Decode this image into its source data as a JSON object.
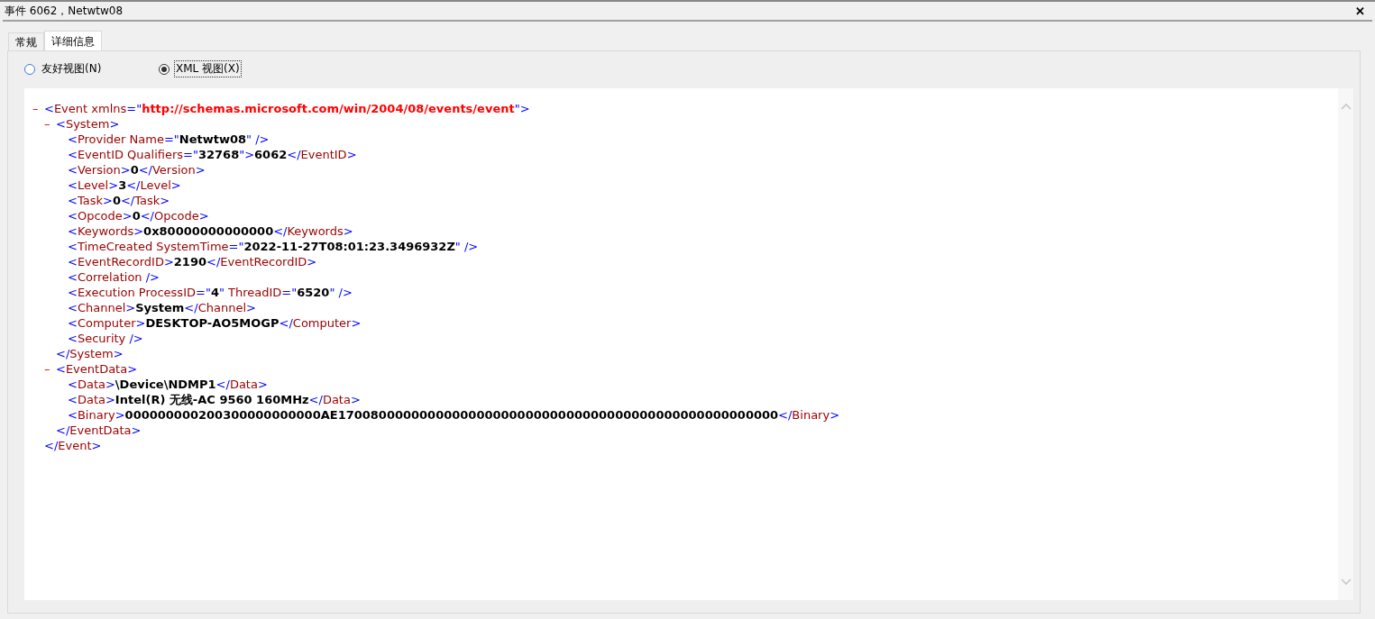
{
  "window": {
    "title": "事件 6062，Netwtw08",
    "close": "✕"
  },
  "tabs": [
    {
      "label": "常规",
      "selected": false
    },
    {
      "label": "详细信息",
      "selected": true
    }
  ],
  "view_options": [
    {
      "label": "友好视图(N)",
      "selected": false
    },
    {
      "label": "XML 视图(X)",
      "selected": true
    }
  ],
  "xml": {
    "toggle": "–",
    "open": [
      {
        "kind": "punct",
        "text": "<"
      },
      {
        "kind": "name",
        "text": "Event xmlns"
      },
      {
        "kind": "punct",
        "text": "=\""
      },
      {
        "kind": "url",
        "text": "http://schemas.microsoft.com/win/2004/08/events/event"
      },
      {
        "kind": "punct",
        "text": "\">"
      }
    ],
    "children": [
      {
        "toggle": "–",
        "open": [
          {
            "kind": "punct",
            "text": "<"
          },
          {
            "kind": "name",
            "text": "System"
          },
          {
            "kind": "punct",
            "text": ">"
          }
        ],
        "children": [
          {
            "open": [
              {
                "kind": "punct",
                "text": "<"
              },
              {
                "kind": "name",
                "text": "Provider Name"
              },
              {
                "kind": "punct",
                "text": "=\""
              },
              {
                "kind": "value",
                "text": "Netwtw08"
              },
              {
                "kind": "punct",
                "text": "\" />"
              }
            ]
          },
          {
            "open": [
              {
                "kind": "punct",
                "text": "<"
              },
              {
                "kind": "name",
                "text": "EventID Qualifiers"
              },
              {
                "kind": "punct",
                "text": "=\""
              },
              {
                "kind": "value",
                "text": "32768"
              },
              {
                "kind": "punct",
                "text": "\">"
              },
              {
                "kind": "value",
                "text": "6062"
              },
              {
                "kind": "punct",
                "text": "</"
              },
              {
                "kind": "name",
                "text": "EventID"
              },
              {
                "kind": "punct",
                "text": ">"
              }
            ]
          },
          {
            "open": [
              {
                "kind": "punct",
                "text": "<"
              },
              {
                "kind": "name",
                "text": "Version"
              },
              {
                "kind": "punct",
                "text": ">"
              },
              {
                "kind": "value",
                "text": "0"
              },
              {
                "kind": "punct",
                "text": "</"
              },
              {
                "kind": "name",
                "text": "Version"
              },
              {
                "kind": "punct",
                "text": ">"
              }
            ]
          },
          {
            "open": [
              {
                "kind": "punct",
                "text": "<"
              },
              {
                "kind": "name",
                "text": "Level"
              },
              {
                "kind": "punct",
                "text": ">"
              },
              {
                "kind": "value",
                "text": "3"
              },
              {
                "kind": "punct",
                "text": "</"
              },
              {
                "kind": "name",
                "text": "Level"
              },
              {
                "kind": "punct",
                "text": ">"
              }
            ]
          },
          {
            "open": [
              {
                "kind": "punct",
                "text": "<"
              },
              {
                "kind": "name",
                "text": "Task"
              },
              {
                "kind": "punct",
                "text": ">"
              },
              {
                "kind": "value",
                "text": "0"
              },
              {
                "kind": "punct",
                "text": "</"
              },
              {
                "kind": "name",
                "text": "Task"
              },
              {
                "kind": "punct",
                "text": ">"
              }
            ]
          },
          {
            "open": [
              {
                "kind": "punct",
                "text": "<"
              },
              {
                "kind": "name",
                "text": "Opcode"
              },
              {
                "kind": "punct",
                "text": ">"
              },
              {
                "kind": "value",
                "text": "0"
              },
              {
                "kind": "punct",
                "text": "</"
              },
              {
                "kind": "name",
                "text": "Opcode"
              },
              {
                "kind": "punct",
                "text": ">"
              }
            ]
          },
          {
            "open": [
              {
                "kind": "punct",
                "text": "<"
              },
              {
                "kind": "name",
                "text": "Keywords"
              },
              {
                "kind": "punct",
                "text": ">"
              },
              {
                "kind": "value",
                "text": "0x80000000000000"
              },
              {
                "kind": "punct",
                "text": "</"
              },
              {
                "kind": "name",
                "text": "Keywords"
              },
              {
                "kind": "punct",
                "text": ">"
              }
            ]
          },
          {
            "open": [
              {
                "kind": "punct",
                "text": "<"
              },
              {
                "kind": "name",
                "text": "TimeCreated SystemTime"
              },
              {
                "kind": "punct",
                "text": "=\""
              },
              {
                "kind": "value",
                "text": "2022-11-27T08:01:23.3496932Z"
              },
              {
                "kind": "punct",
                "text": "\" />"
              }
            ]
          },
          {
            "open": [
              {
                "kind": "punct",
                "text": "<"
              },
              {
                "kind": "name",
                "text": "EventRecordID"
              },
              {
                "kind": "punct",
                "text": ">"
              },
              {
                "kind": "value",
                "text": "2190"
              },
              {
                "kind": "punct",
                "text": "</"
              },
              {
                "kind": "name",
                "text": "EventRecordID"
              },
              {
                "kind": "punct",
                "text": ">"
              }
            ]
          },
          {
            "open": [
              {
                "kind": "punct",
                "text": "<"
              },
              {
                "kind": "name",
                "text": "Correlation"
              },
              {
                "kind": "punct",
                "text": " />"
              }
            ]
          },
          {
            "open": [
              {
                "kind": "punct",
                "text": "<"
              },
              {
                "kind": "name",
                "text": "Execution ProcessID"
              },
              {
                "kind": "punct",
                "text": "=\""
              },
              {
                "kind": "value",
                "text": "4"
              },
              {
                "kind": "punct",
                "text": "\""
              },
              {
                "kind": "name",
                "text": " ThreadID"
              },
              {
                "kind": "punct",
                "text": "=\""
              },
              {
                "kind": "value",
                "text": "6520"
              },
              {
                "kind": "punct",
                "text": "\" />"
              }
            ]
          },
          {
            "open": [
              {
                "kind": "punct",
                "text": "<"
              },
              {
                "kind": "name",
                "text": "Channel"
              },
              {
                "kind": "punct",
                "text": ">"
              },
              {
                "kind": "value",
                "text": "System"
              },
              {
                "kind": "punct",
                "text": "</"
              },
              {
                "kind": "name",
                "text": "Channel"
              },
              {
                "kind": "punct",
                "text": ">"
              }
            ]
          },
          {
            "open": [
              {
                "kind": "punct",
                "text": "<"
              },
              {
                "kind": "name",
                "text": "Computer"
              },
              {
                "kind": "punct",
                "text": ">"
              },
              {
                "kind": "value",
                "text": "DESKTOP-AO5MOGP"
              },
              {
                "kind": "punct",
                "text": "</"
              },
              {
                "kind": "name",
                "text": "Computer"
              },
              {
                "kind": "punct",
                "text": ">"
              }
            ]
          },
          {
            "open": [
              {
                "kind": "punct",
                "text": "<"
              },
              {
                "kind": "name",
                "text": "Security"
              },
              {
                "kind": "punct",
                "text": " />"
              }
            ]
          }
        ],
        "close": [
          {
            "kind": "punct",
            "text": "</"
          },
          {
            "kind": "name",
            "text": "System"
          },
          {
            "kind": "punct",
            "text": ">"
          }
        ]
      },
      {
        "toggle": "–",
        "open": [
          {
            "kind": "punct",
            "text": "<"
          },
          {
            "kind": "name",
            "text": "EventData"
          },
          {
            "kind": "punct",
            "text": ">"
          }
        ],
        "children": [
          {
            "open": [
              {
                "kind": "punct",
                "text": "<"
              },
              {
                "kind": "name",
                "text": "Data"
              },
              {
                "kind": "punct",
                "text": ">"
              },
              {
                "kind": "value",
                "text": "\\Device\\NDMP1"
              },
              {
                "kind": "punct",
                "text": "</"
              },
              {
                "kind": "name",
                "text": "Data"
              },
              {
                "kind": "punct",
                "text": ">"
              }
            ]
          },
          {
            "open": [
              {
                "kind": "punct",
                "text": "<"
              },
              {
                "kind": "name",
                "text": "Data"
              },
              {
                "kind": "punct",
                "text": ">"
              },
              {
                "kind": "value",
                "text": "Intel(R) 无线-AC 9560 160MHz"
              },
              {
                "kind": "punct",
                "text": "</"
              },
              {
                "kind": "name",
                "text": "Data"
              },
              {
                "kind": "punct",
                "text": ">"
              }
            ]
          },
          {
            "open": [
              {
                "kind": "punct",
                "text": "<"
              },
              {
                "kind": "name",
                "text": "Binary"
              },
              {
                "kind": "punct",
                "text": ">"
              },
              {
                "kind": "value",
                "text": "000000000200300000000000AE170080000000000000000000000000000000000000000000000000"
              },
              {
                "kind": "punct",
                "text": "</"
              },
              {
                "kind": "name",
                "text": "Binary"
              },
              {
                "kind": "punct",
                "text": ">"
              }
            ]
          }
        ],
        "close": [
          {
            "kind": "punct",
            "text": "</"
          },
          {
            "kind": "name",
            "text": "EventData"
          },
          {
            "kind": "punct",
            "text": ">"
          }
        ]
      }
    ],
    "close": [
      {
        "kind": "punct",
        "text": "</"
      },
      {
        "kind": "name",
        "text": "Event"
      },
      {
        "kind": "punct",
        "text": ">"
      }
    ]
  }
}
